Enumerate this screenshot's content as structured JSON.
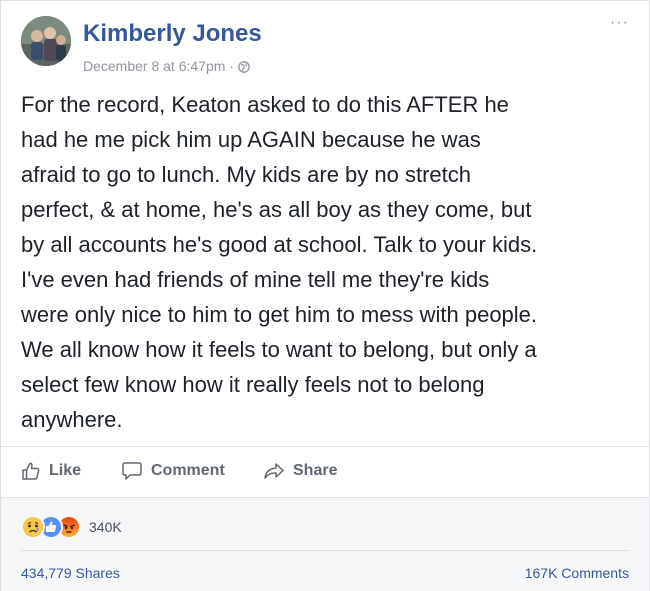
{
  "header": {
    "name": "Kimberly Jones",
    "date": "December 8 at 6:47pm",
    "separator": "·",
    "more_label": "···"
  },
  "post": {
    "text": "For the record, Keaton asked to do this AFTER he\nhad he me pick him up AGAIN because he was\nafraid to go to lunch. My kids are by no stretch\nperfect, & at home, he's as all boy as they come, but\nby all accounts he's good at school. Talk to your kids.\nI've even had friends of mine tell me they're kids\nwere only nice to him to get him to mess with people.\nWe all know how it feels to want to belong, but only a\nselect few know how it really feels not to belong\nanywhere."
  },
  "actions": {
    "like": "Like",
    "comment": "Comment",
    "share": "Share"
  },
  "footer": {
    "reaction_icons": [
      "sad-icon",
      "like-icon",
      "angry-icon"
    ],
    "reaction_count": "340K",
    "shares": "434,779 Shares",
    "comments": "167K Comments"
  },
  "colors": {
    "name_blue": "#365899",
    "meta_gray": "#90949c",
    "action_gray": "#606770",
    "like_blue": "#5890ff",
    "sad_yellow": "#f7c64a",
    "angry_red": "#e9710f"
  }
}
